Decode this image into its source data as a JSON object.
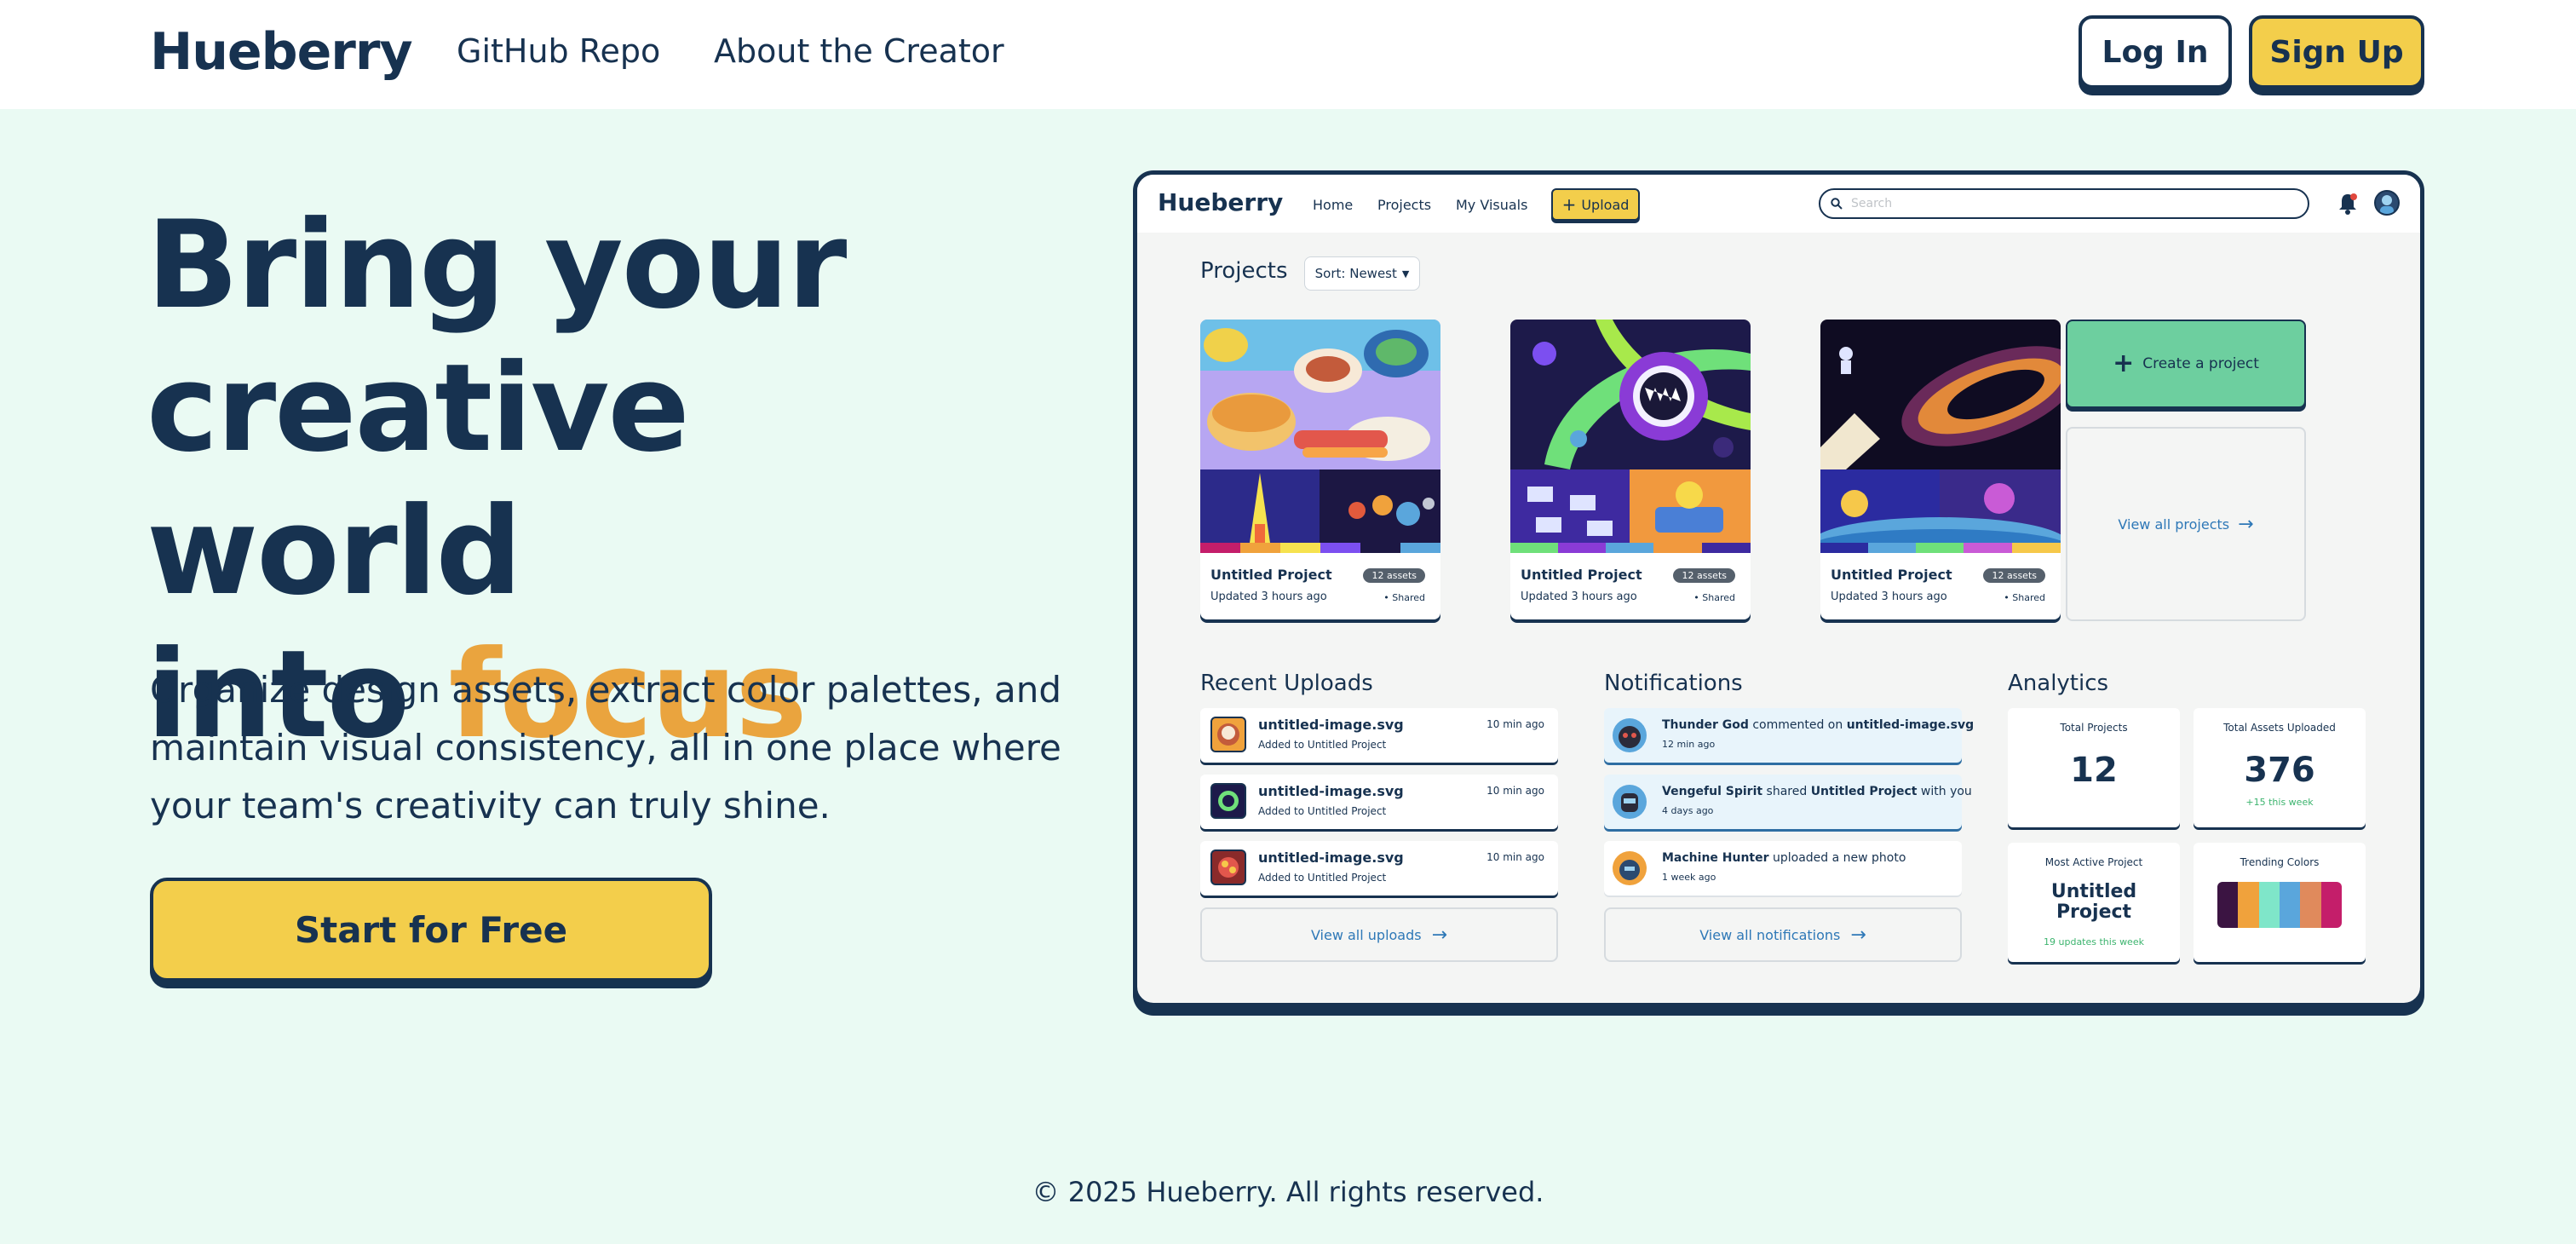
{
  "site": {
    "brand": "Hueberry",
    "nav_links": [
      "GitHub Repo",
      "About the Creator"
    ],
    "login_label": "Log In",
    "signup_label": "Sign Up"
  },
  "hero": {
    "title_line1": "Bring your",
    "title_line2": "creative world",
    "title_line3_prefix": "into ",
    "title_line3_accent": "focus",
    "description": "Organize design assets, extract color palettes, and maintain visual consistency, all in one place where your team's creativity can truly shine.",
    "cta_label": "Start for Free"
  },
  "footer": {
    "text": "© 2025 Hueberry. All rights reserved."
  },
  "mock": {
    "brand": "Hueberry",
    "nav": [
      "Home",
      "Projects",
      "My Visuals"
    ],
    "upload_label": "Upload",
    "search_placeholder": "Search",
    "projects_heading": "Projects",
    "sort_label": "Sort: Newest",
    "projects": [
      {
        "title": "Untitled Project",
        "updated": "Updated 3 hours ago",
        "assets": "12 assets",
        "shared": "• Shared"
      },
      {
        "title": "Untitled Project",
        "updated": "Updated 3 hours ago",
        "assets": "12 assets",
        "shared": "• Shared"
      },
      {
        "title": "Untitled Project",
        "updated": "Updated 3 hours ago",
        "assets": "12 assets",
        "shared": "• Shared"
      }
    ],
    "create_label": "Create a project",
    "view_all_projects": "View all projects",
    "recent_heading": "Recent Uploads",
    "uploads": [
      {
        "name": "untitled-image.svg",
        "sub": "Added to Untitled Project",
        "time": "10 min ago"
      },
      {
        "name": "untitled-image.svg",
        "sub": "Added to Untitled Project",
        "time": "10 min ago"
      },
      {
        "name": "untitled-image.svg",
        "sub": "Added to Untitled Project",
        "time": "10 min ago"
      }
    ],
    "view_all_uploads": "View all uploads",
    "notifications_heading": "Notifications",
    "notifications": [
      {
        "user": "Thunder God",
        "action": " commented on ",
        "target": "untitled-image.svg",
        "suffix": "",
        "time": "12 min ago"
      },
      {
        "user": "Vengeful Spirit",
        "action": " shared ",
        "target": "Untitled Project",
        "suffix": " with you",
        "time": "4 days ago"
      },
      {
        "user": "Machine Hunter",
        "action": " uploaded a new photo",
        "target": "",
        "suffix": "",
        "time": "1 week ago"
      }
    ],
    "view_all_notifications": "View all notifications",
    "analytics_heading": "Analytics",
    "analytics": {
      "total_projects_label": "Total Projects",
      "total_projects": "12",
      "total_assets_label": "Total Assets Uploaded",
      "total_assets": "376",
      "assets_delta": "+15 this week",
      "most_active_label": "Most Active Project",
      "most_active_line1": "Untitled",
      "most_active_line2": "Project",
      "most_active_delta": "19 updates this week",
      "trending_label": "Trending Colors",
      "trending_colors": [
        "#3b1442",
        "#f0a23c",
        "#7fe6c9",
        "#5aa6dc",
        "#e08a5c",
        "#c41e6a"
      ]
    }
  },
  "colors": {
    "navy": "#173250",
    "yellow": "#f3ce4b",
    "accent_orange": "#eaa43e",
    "mint_bg": "#eafaf3",
    "green": "#6dcf9f",
    "link_blue": "#2e78b7"
  }
}
